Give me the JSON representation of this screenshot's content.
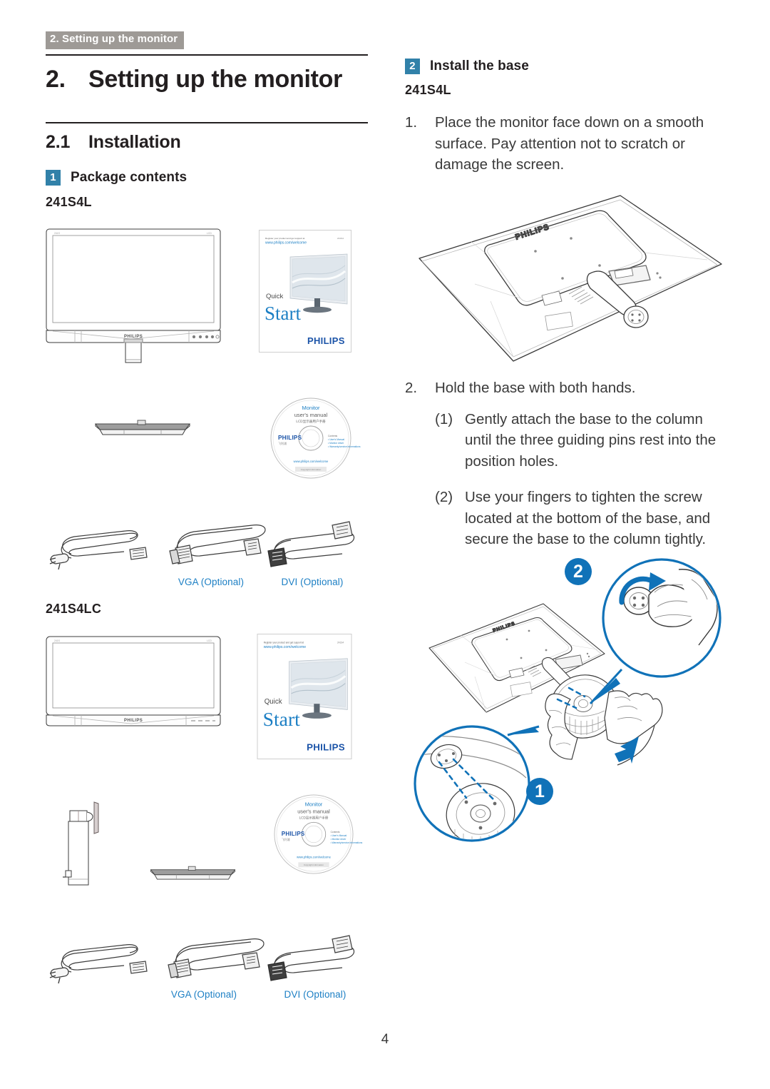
{
  "running_header": "2. Setting up the monitor",
  "chapter": {
    "number": "2.",
    "title": "Setting up the monitor"
  },
  "section": {
    "number": "2.1",
    "title": "Installation"
  },
  "left_column": {
    "subhead": {
      "badge": "1",
      "label": "Package contents"
    },
    "model_1": "241S4L",
    "model_2": "241S4LC",
    "captions_top": {
      "vga": "VGA (Optional)",
      "dvi": "DVI (Optional)"
    },
    "captions_bottom": {
      "vga": "VGA (Optional)",
      "dvi": "DVI (Optional)"
    }
  },
  "right_column": {
    "subhead": {
      "badge": "2",
      "label": "Install the base"
    },
    "model": "241S4L",
    "steps": [
      {
        "marker": "1.",
        "text": "Place the monitor face down on a smooth surface. Pay attention not to scratch or damage the screen."
      },
      {
        "marker": "2.",
        "text": "Hold the base with both hands.",
        "substeps": [
          {
            "marker": "(1)",
            "text": "Gently attach the base to the column until the three guiding pins rest into the position holes."
          },
          {
            "marker": "(2)",
            "text": "Use your fingers to tighten the screw located at the bottom of the base, and secure the base to the column tightly."
          }
        ]
      }
    ],
    "callouts": {
      "one": "1",
      "two": "2"
    }
  },
  "artwork": {
    "quickstart_guide": {
      "url_line1": "Register your product and get support at",
      "url_line2": "www.philips.com/welcome",
      "corner_code": "241S4",
      "word_quick": "Quick",
      "word_start": "Start",
      "brand": "PHILIPS"
    },
    "cd_disc": {
      "line1": "Monitor",
      "line2": "user's manual",
      "line3": "LCD显示器用户手册",
      "brand": "PHILIPS",
      "brand_sub": "飞利浦",
      "contents_title": "Contents",
      "contents": [
        "User's Manual",
        "Monitor driver",
        "Warranty/service informations"
      ],
      "url": "www.philips.com/welcome",
      "footer": "Copyright information"
    },
    "monitor_brand": "PHILIPS"
  },
  "page_number": "4",
  "colors": {
    "header_badge_bg": "#9e9a96",
    "step_badge_blue": "#3181a9",
    "caption_blue": "#1c7fc4",
    "callout_blue": "#1072b8",
    "text": "#231f20",
    "body_text": "#3a3a3a",
    "line_art": "#3c3c3c"
  }
}
